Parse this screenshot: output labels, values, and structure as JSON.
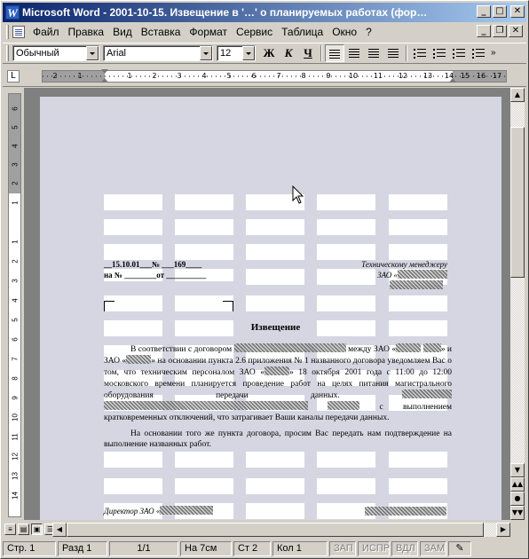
{
  "window": {
    "title": "Microsoft Word - 2001-10-15. Извещение в '…' о планируемых работах (фор…",
    "app_icon": "W"
  },
  "menu": {
    "items": [
      {
        "label": "Файл"
      },
      {
        "label": "Правка"
      },
      {
        "label": "Вид"
      },
      {
        "label": "Вставка"
      },
      {
        "label": "Формат"
      },
      {
        "label": "Сервис"
      },
      {
        "label": "Таблица"
      },
      {
        "label": "Окно"
      },
      {
        "label": "?"
      }
    ]
  },
  "toolbar": {
    "style": "Обычный",
    "font": "Arial",
    "size": "12",
    "bold": "Ж",
    "italic": "К",
    "underline": "Ч"
  },
  "ruler": {
    "ticks": [
      "2",
      "1",
      "1",
      "2",
      "3",
      "4",
      "5",
      "6",
      "7",
      "8",
      "9",
      "10",
      "11",
      "12",
      "13",
      "14",
      "15",
      "16",
      "17",
      "18"
    ],
    "corner": "L"
  },
  "vruler": {
    "ticks": [
      "6",
      "5",
      "4",
      "3",
      "2",
      "1",
      "1",
      "2",
      "3",
      "4",
      "5",
      "6",
      "7",
      "8",
      "9",
      "10",
      "11",
      "12",
      "13",
      "14"
    ]
  },
  "document": {
    "ref_line1": "__15.10.01___№ ___169____",
    "ref_line2": "на № ________от __________",
    "recipient_line1": "Техническому менеджеру",
    "recipient_line2": "ЗАО «",
    "heading": "Извещение",
    "para1_a": "В соответствии с договором",
    "para1_b": "между ЗАО «",
    "para1_c": "» и ЗАО «",
    "para1_d": "» на основании пункта 2.6 приложения № 1 названного договора уведомляем Вас о том, что техническим персоналом ЗАО «",
    "para1_e": "» 18 октября 2001 года с 11:00 до 12:00 московского времени планируется проведение работ на целях питания магистрального оборудования передачи данных.",
    "para1_f": "с выполнением кратковременных отключений, что затрагивает Ваши каналы передачи данных.",
    "para2": "На основании того же пункта договора, просим Вас передать нам подтверждение на выполнение названных работ.",
    "signature": "Директор ЗАО «"
  },
  "status": {
    "page": "Стр. 1",
    "section": "Разд 1",
    "pages": "1/1",
    "at": "На 7см",
    "line": "Ст 2",
    "col": "Кол 1",
    "rec": "ЗАП",
    "trk": "ИСПР",
    "ext": "ВДЛ",
    "ovr": "ЗАМ"
  }
}
